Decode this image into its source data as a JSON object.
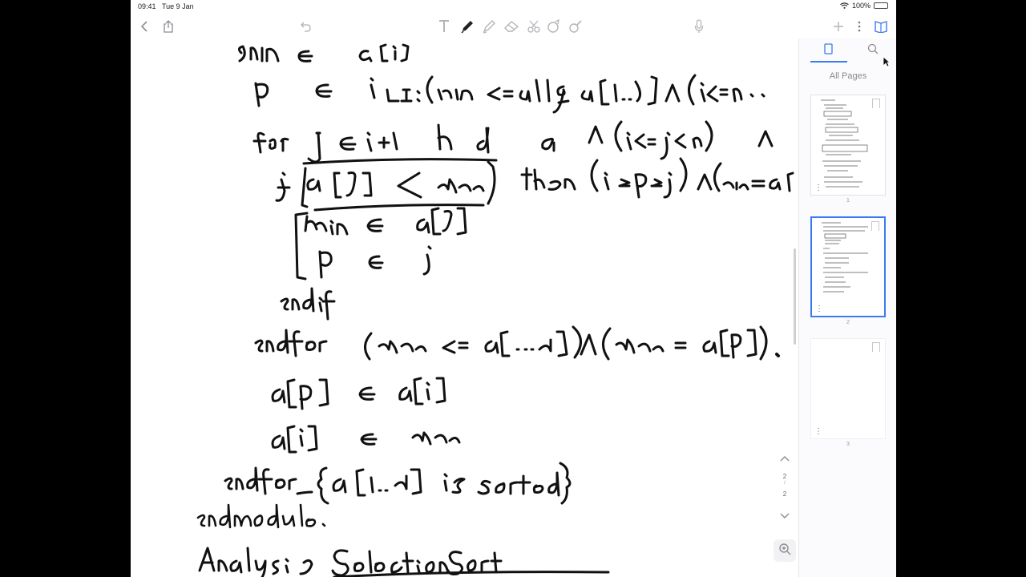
{
  "status_bar": {
    "time": "09:41",
    "date": "Tue 9 Jan",
    "battery_percent": "100%"
  },
  "toolbar": {
    "tools": [
      "back-icon",
      "share-icon",
      "undo-icon",
      "text-tool-icon",
      "pen-icon",
      "highlighter-icon",
      "eraser-icon",
      "lasso-icon",
      "shapes-icon",
      "image-icon",
      "microphone-icon",
      "add-page-icon",
      "more-icon",
      "sidebar-toggle-icon"
    ],
    "active_tool": "pen-icon",
    "accent_color": "#3a7bf0"
  },
  "sidebar": {
    "label": "All Pages",
    "pages": [
      {
        "number": "1",
        "selected": false
      },
      {
        "number": "2",
        "selected": true
      },
      {
        "number": "3",
        "selected": false
      }
    ]
  },
  "page_navigator": {
    "current": "2",
    "separator": "/",
    "total": "2"
  },
  "canvas": {
    "content": "handwritten-selection-sort-pseudocode"
  }
}
